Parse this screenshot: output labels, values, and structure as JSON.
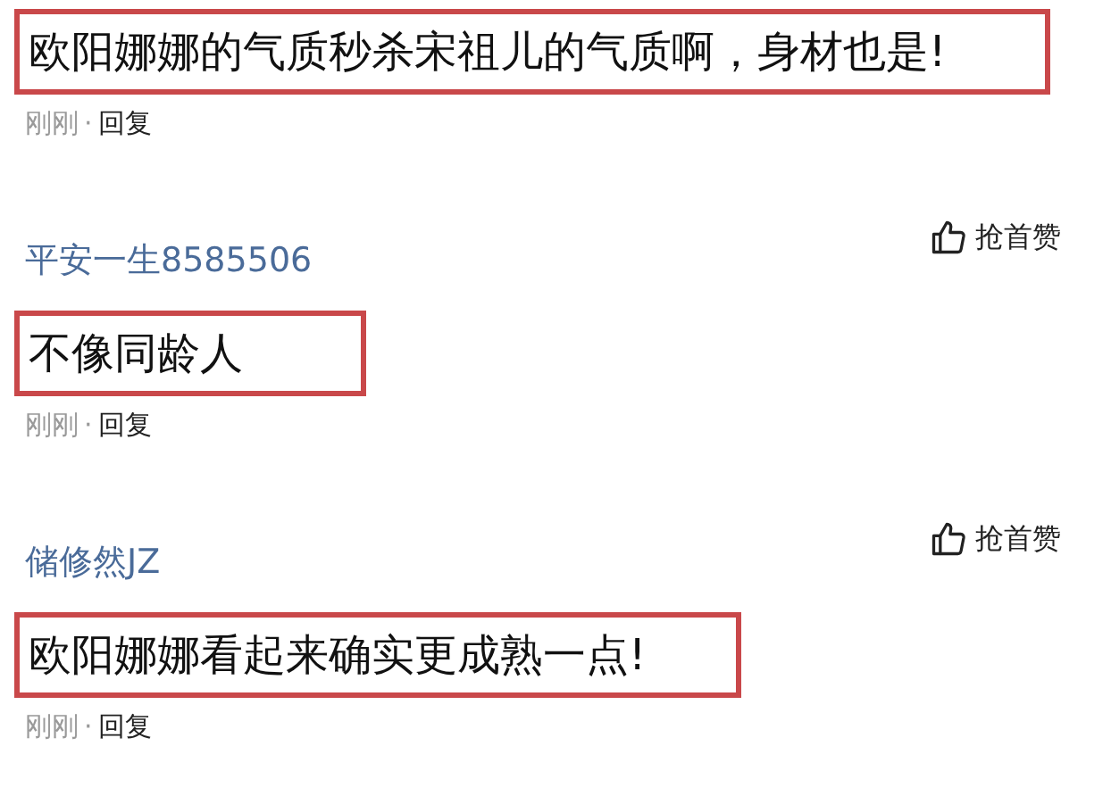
{
  "comments": [
    {
      "text": "欧阳娜娜的气质秒杀宋祖儿的气质啊，身材也是!",
      "highlighted": true,
      "meta": {
        "time": "刚刚",
        "separator": "·",
        "reply": "回复"
      }
    },
    {
      "author": "平安一生8585506",
      "like": "抢首赞",
      "text": "不像同龄人",
      "highlighted": true,
      "meta": {
        "time": "刚刚",
        "separator": "·",
        "reply": "回复"
      }
    },
    {
      "author": "储修然JZ",
      "like": "抢首赞",
      "text": "欧阳娜娜看起来确实更成熟一点!",
      "highlighted": true,
      "meta": {
        "time": "刚刚",
        "separator": "·",
        "reply": "回复"
      }
    }
  ]
}
